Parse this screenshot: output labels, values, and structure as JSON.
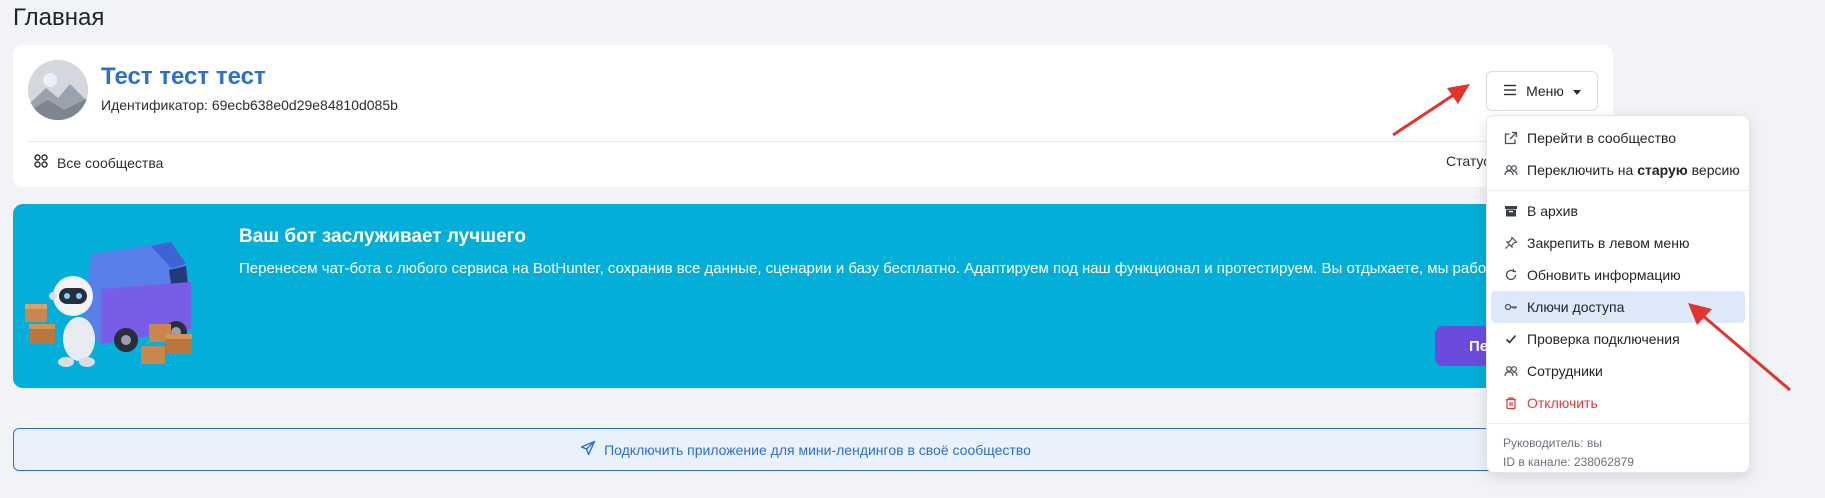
{
  "page": {
    "title": "Главная"
  },
  "community": {
    "name": "Тест тест тест",
    "id_label": "Идентификатор: 69ecb638e0d29e84810d085b",
    "all_communities": "Все сообщества",
    "status_label": "Статус"
  },
  "banner": {
    "title": "Ваш бот заслуживает лучшего",
    "text": "Перенесем чат-бота с любого сервиса на BotHunter, сохранив все данные, сценарии и базу бесплатно. Адаптируем под наш функционал и протестируем. Вы отдыхаете, мы работаем.",
    "button": "Пе"
  },
  "connect": {
    "label": "Подключить приложение для мини-лендингов в своё сообщество"
  },
  "menu": {
    "button_label": "Меню",
    "items": [
      {
        "label": "Перейти в сообщество",
        "icon": "external-link-icon"
      },
      {
        "label_pre": "Переключить на ",
        "label_bold": "старую",
        "label_post": " версию",
        "icon": "users-icon"
      },
      {
        "label": "В архив",
        "icon": "archive-icon"
      },
      {
        "label": "Закрепить в левом меню",
        "icon": "pin-icon"
      },
      {
        "label": "Обновить информацию",
        "icon": "refresh-icon"
      },
      {
        "label": "Ключи доступа",
        "icon": "key-icon"
      },
      {
        "label": "Проверка подключения",
        "icon": "check-icon"
      },
      {
        "label": "Сотрудники",
        "icon": "team-icon"
      },
      {
        "label": "Отключить",
        "icon": "trash-icon"
      }
    ],
    "footer": {
      "manager": "Руководитель: вы",
      "channel_id": "ID в канале: 238062879"
    }
  },
  "colors": {
    "accent": "#2b6fd6",
    "banner": "#03aed8",
    "banner_button": "#6b4bdc",
    "danger": "#e03b3b",
    "arrow": "#e0342c"
  }
}
